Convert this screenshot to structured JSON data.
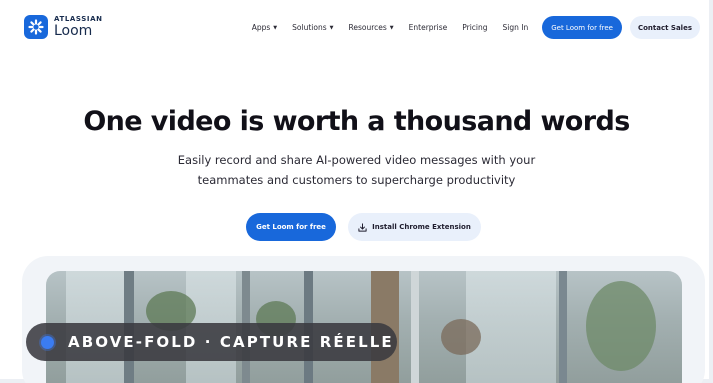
{
  "brand": {
    "company": "ATLASSIAN",
    "product": "Loom",
    "accent": "#1868db"
  },
  "nav": {
    "items": [
      {
        "label": "Apps",
        "has_dropdown": true
      },
      {
        "label": "Solutions",
        "has_dropdown": true
      },
      {
        "label": "Resources",
        "has_dropdown": true
      },
      {
        "label": "Enterprise",
        "has_dropdown": false
      },
      {
        "label": "Pricing",
        "has_dropdown": false
      },
      {
        "label": "Sign In",
        "has_dropdown": false
      }
    ],
    "cta_primary": "Get Loom for free",
    "cta_secondary": "Contact Sales"
  },
  "hero": {
    "title": "One video is worth a thousand words",
    "subtitle_line1": "Easily record and share AI-powered video messages with your",
    "subtitle_line2": "teammates and customers to supercharge productivity",
    "cta_primary": "Get Loom for free",
    "cta_secondary": "Install Chrome Extension"
  },
  "overlay_badge": {
    "text": "ABOVE-FOLD · CAPTURE RÉELLE"
  }
}
